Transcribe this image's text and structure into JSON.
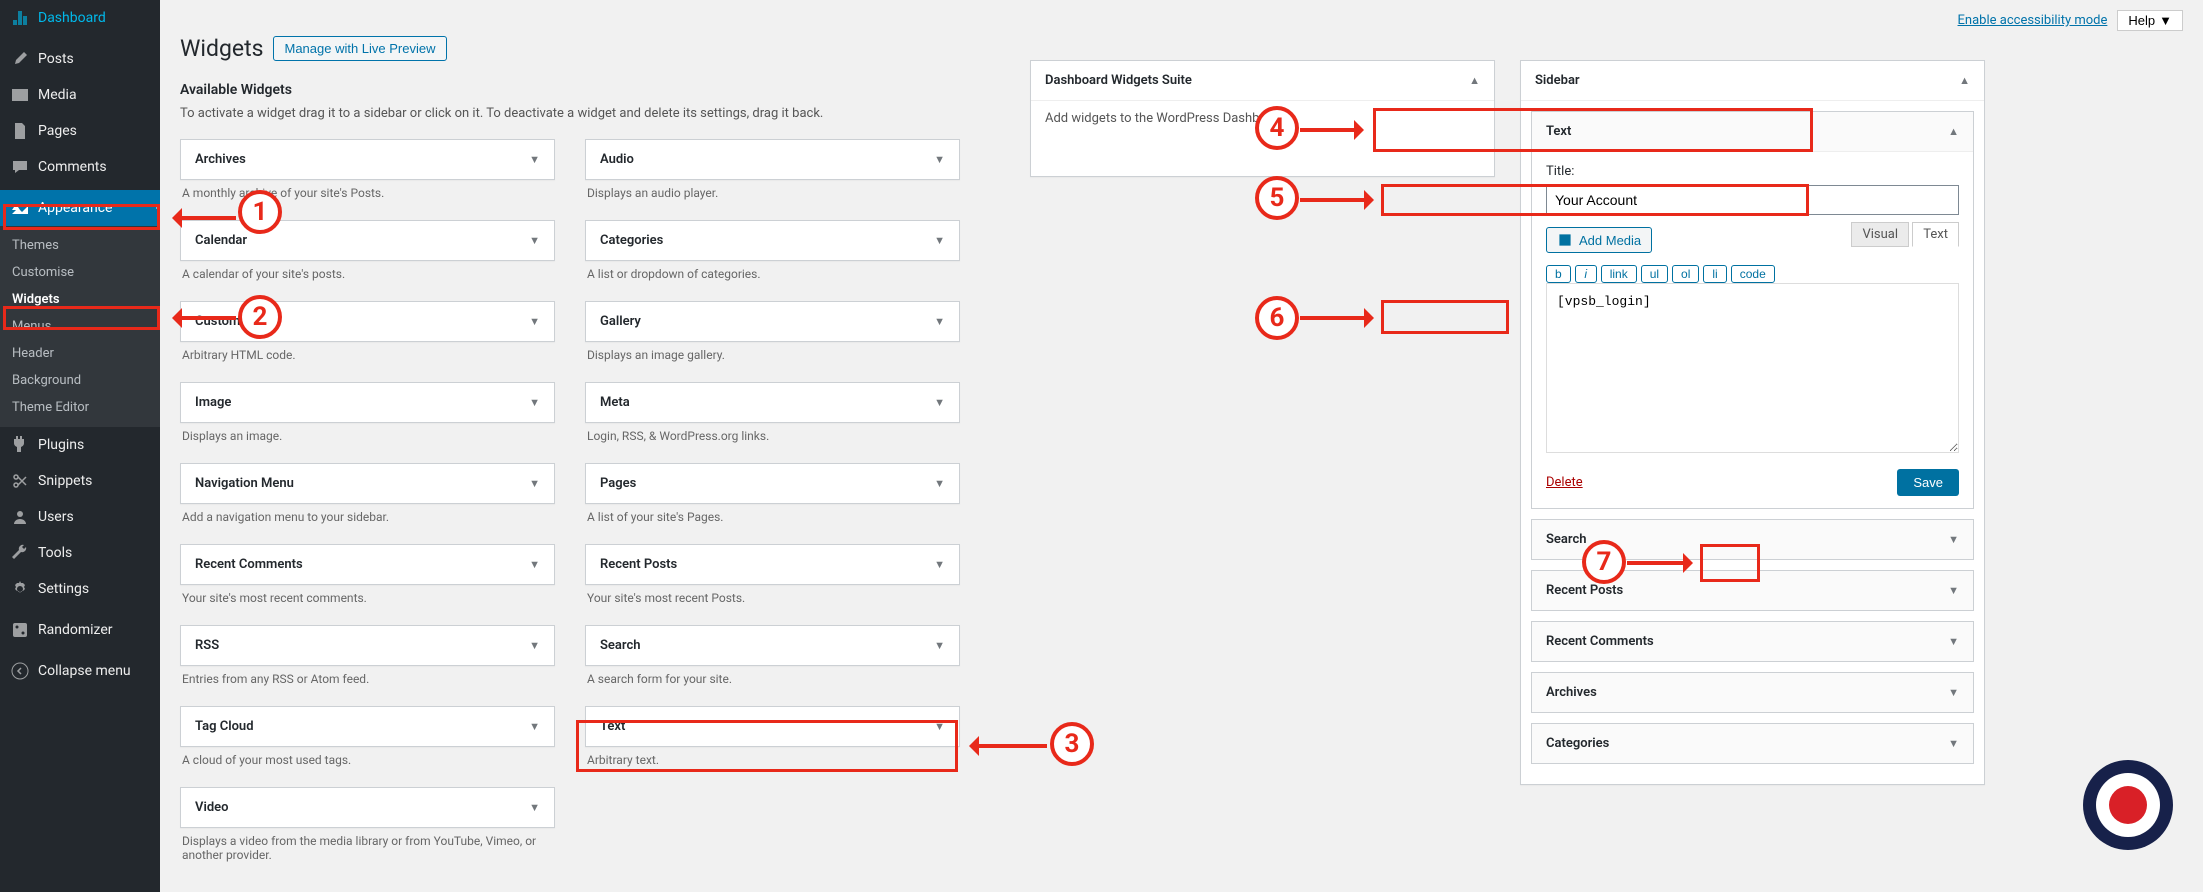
{
  "top": {
    "accessibility": "Enable accessibility mode",
    "help": "Help"
  },
  "page": {
    "title": "Widgets",
    "manage_btn": "Manage with Live Preview",
    "available_heading": "Available Widgets",
    "available_desc": "To activate a widget drag it to a sidebar or click on it. To deactivate a widget and delete its settings, drag it back."
  },
  "menu": {
    "dashboard": "Dashboard",
    "posts": "Posts",
    "media": "Media",
    "pages": "Pages",
    "comments": "Comments",
    "appearance": "Appearance",
    "plugins": "Plugins",
    "snippets": "Snippets",
    "users": "Users",
    "tools": "Tools",
    "settings": "Settings",
    "randomizer": "Randomizer",
    "collapse": "Collapse menu"
  },
  "submenu": {
    "themes": "Themes",
    "customise": "Customise",
    "widgets": "Widgets",
    "menus": "Menus",
    "header": "Header",
    "background": "Background",
    "theme_editor": "Theme Editor"
  },
  "widgets": {
    "archives": {
      "label": "Archives",
      "desc": "A monthly archive of your site's Posts."
    },
    "audio": {
      "label": "Audio",
      "desc": "Displays an audio player."
    },
    "calendar": {
      "label": "Calendar",
      "desc": "A calendar of your site's posts."
    },
    "categories": {
      "label": "Categories",
      "desc": "A list or dropdown of categories."
    },
    "custom_html": {
      "label": "Custom HTML",
      "desc": "Arbitrary HTML code."
    },
    "gallery": {
      "label": "Gallery",
      "desc": "Displays an image gallery."
    },
    "image": {
      "label": "Image",
      "desc": "Displays an image."
    },
    "meta": {
      "label": "Meta",
      "desc": "Login, RSS, & WordPress.org links."
    },
    "nav_menu": {
      "label": "Navigation Menu",
      "desc": "Add a navigation menu to your sidebar."
    },
    "pages": {
      "label": "Pages",
      "desc": "A list of your site's Pages."
    },
    "recent_comments": {
      "label": "Recent Comments",
      "desc": "Your site's most recent comments."
    },
    "recent_posts": {
      "label": "Recent Posts",
      "desc": "Your site's most recent Posts."
    },
    "rss": {
      "label": "RSS",
      "desc": "Entries from any RSS or Atom feed."
    },
    "search": {
      "label": "Search",
      "desc": "A search form for your site."
    },
    "tag_cloud": {
      "label": "Tag Cloud",
      "desc": "A cloud of your most used tags."
    },
    "text": {
      "label": "Text",
      "desc": "Arbitrary text."
    },
    "video": {
      "label": "Video",
      "desc": "Displays a video from the media library or from YouTube, Vimeo, or another provider."
    }
  },
  "drop": {
    "dashboard": {
      "title": "Dashboard Widgets Suite",
      "desc": "Add widgets to the WordPress Dashboard"
    },
    "sidebar": {
      "title": "Sidebar"
    }
  },
  "text_widget": {
    "header": "Text",
    "title_label": "Title:",
    "title_value": "Your Account",
    "add_media": "Add Media",
    "tabs": {
      "visual": "Visual",
      "text": "Text"
    },
    "toolbar": {
      "b": "b",
      "i": "i",
      "link": "link",
      "ul": "ul",
      "ol": "ol",
      "li": "li",
      "code": "code"
    },
    "content": "[vpsb_login]",
    "delete": "Delete",
    "save": "Save"
  },
  "sidebar_widgets": {
    "search": "Search",
    "recent_posts": "Recent Posts",
    "recent_comments": "Recent Comments",
    "archives": "Archives",
    "categories": "Categories"
  },
  "annotations": [
    "1",
    "2",
    "3",
    "4",
    "5",
    "6",
    "7"
  ]
}
